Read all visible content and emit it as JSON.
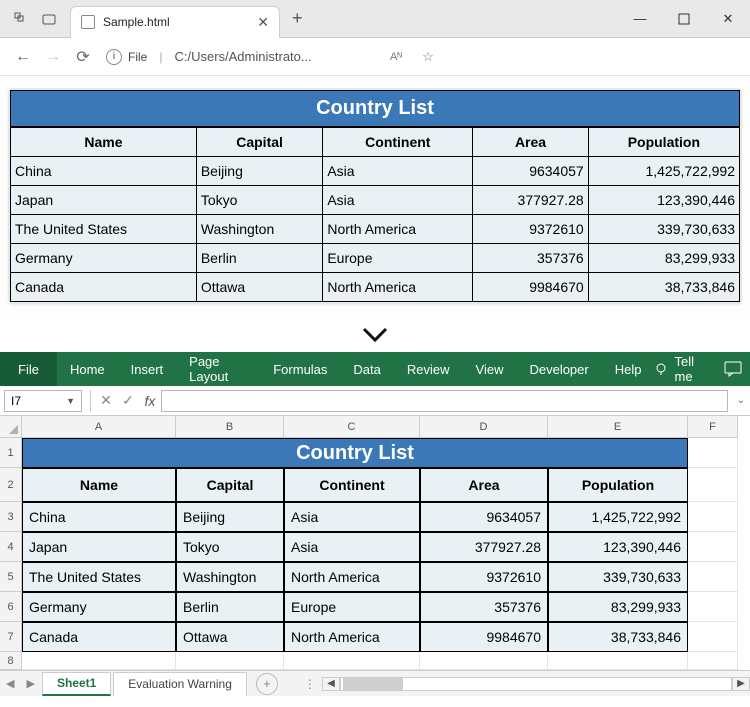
{
  "browser": {
    "tab_title": "Sample.html",
    "url_label": "File",
    "url_text": "C:/Users/Administrato...",
    "reader_label": "Aᴺ"
  },
  "page_table": {
    "title": "Country List",
    "headers": [
      "Name",
      "Capital",
      "Continent",
      "Area",
      "Population"
    ],
    "rows": [
      {
        "name": "China",
        "capital": "Beijing",
        "continent": "Asia",
        "area": "9634057",
        "population": "1,425,722,992"
      },
      {
        "name": "Japan",
        "capital": "Tokyo",
        "continent": "Asia",
        "area": "377927.28",
        "population": "123,390,446"
      },
      {
        "name": "The United States",
        "capital": "Washington",
        "continent": "North America",
        "area": "9372610",
        "population": "339,730,633"
      },
      {
        "name": "Germany",
        "capital": "Berlin",
        "continent": "Europe",
        "area": "357376",
        "population": "83,299,933"
      },
      {
        "name": "Canada",
        "capital": "Ottawa",
        "continent": "North America",
        "area": "9984670",
        "population": "38,733,846"
      }
    ]
  },
  "excel": {
    "ribbon": [
      "File",
      "Home",
      "Insert",
      "Page Layout",
      "Formulas",
      "Data",
      "Review",
      "View",
      "Developer",
      "Help"
    ],
    "tell_me": "Tell me",
    "name_box": "I7",
    "fx_label": "fx",
    "columns": [
      "A",
      "B",
      "C",
      "D",
      "E",
      "F"
    ],
    "rows": [
      "1",
      "2",
      "3",
      "4",
      "5",
      "6",
      "7",
      "8"
    ],
    "sheet_tabs": [
      "Sheet1",
      "Evaluation Warning"
    ],
    "table": {
      "title": "Country List",
      "headers": [
        "Name",
        "Capital",
        "Continent",
        "Area",
        "Population"
      ],
      "rows": [
        {
          "name": "China",
          "capital": "Beijing",
          "continent": "Asia",
          "area": "9634057",
          "population": "1,425,722,992"
        },
        {
          "name": "Japan",
          "capital": "Tokyo",
          "continent": "Asia",
          "area": "377927.28",
          "population": "123,390,446"
        },
        {
          "name": "The United States",
          "capital": "Washington",
          "continent": "North America",
          "area": "9372610",
          "population": "339,730,633"
        },
        {
          "name": "Germany",
          "capital": "Berlin",
          "continent": "Europe",
          "area": "357376",
          "population": "83,299,933"
        },
        {
          "name": "Canada",
          "capital": "Ottawa",
          "continent": "North America",
          "area": "9984670",
          "population": "38,733,846"
        }
      ]
    }
  }
}
